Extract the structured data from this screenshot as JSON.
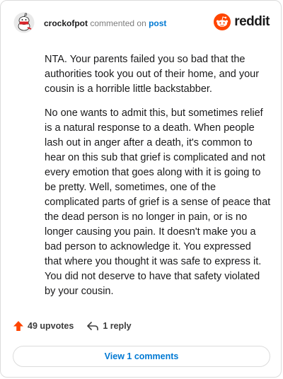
{
  "comment": {
    "author": "crockofpot",
    "action": "commented on",
    "target": "post",
    "paragraphs": [
      "NTA. Your parents failed you so bad that the authorities took you out of their home, and your cousin is a horrible little backstabber.",
      "No one wants to admit this, but sometimes relief is a natural response to a death. When people lash out in anger after a death, it's common to hear on this sub that grief is complicated and not every emotion that goes along with it is going to be pretty. Well, sometimes, one of the complicated parts of grief is a sense of peace that the dead person is no longer in pain, or is no longer causing you pain. It doesn't make you a bad person to acknowledge it. You expressed that where you thought it was safe to express it. You did not deserve to have that safety violated by your cousin."
    ]
  },
  "brand": {
    "name": "reddit",
    "icon": "reddit-logo-icon",
    "color": "#ff4500"
  },
  "footer": {
    "upvotes_label": "49 upvotes",
    "replies_label": "1 reply",
    "view_comments_label": "View 1 comments"
  },
  "colors": {
    "accent": "#0079d3",
    "upvote": "#ff4500"
  }
}
